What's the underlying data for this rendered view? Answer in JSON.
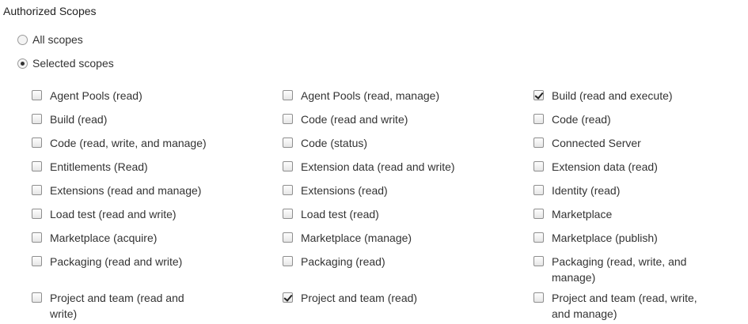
{
  "section": {
    "title": "Authorized Scopes"
  },
  "scope_mode": {
    "options": [
      {
        "label": "All scopes",
        "selected": false
      },
      {
        "label": "Selected scopes",
        "selected": true
      }
    ]
  },
  "scopes": [
    {
      "label": "Agent Pools (read)",
      "checked": false
    },
    {
      "label": "Agent Pools (read, manage)",
      "checked": false
    },
    {
      "label": "Build (read and execute)",
      "checked": true
    },
    {
      "label": "Build (read)",
      "checked": false
    },
    {
      "label": "Code (read and write)",
      "checked": false
    },
    {
      "label": "Code (read)",
      "checked": false
    },
    {
      "label": "Code (read, write, and manage)",
      "checked": false
    },
    {
      "label": "Code (status)",
      "checked": false
    },
    {
      "label": "Connected Server",
      "checked": false
    },
    {
      "label": "Entitlements (Read)",
      "checked": false
    },
    {
      "label": "Extension data (read and write)",
      "checked": false
    },
    {
      "label": "Extension data (read)",
      "checked": false
    },
    {
      "label": "Extensions (read and manage)",
      "checked": false
    },
    {
      "label": "Extensions (read)",
      "checked": false
    },
    {
      "label": "Identity (read)",
      "checked": false
    },
    {
      "label": "Load test (read and write)",
      "checked": false
    },
    {
      "label": "Load test (read)",
      "checked": false
    },
    {
      "label": "Marketplace",
      "checked": false
    },
    {
      "label": "Marketplace (acquire)",
      "checked": false
    },
    {
      "label": "Marketplace (manage)",
      "checked": false
    },
    {
      "label": "Marketplace (publish)",
      "checked": false
    },
    {
      "label": "Packaging (read and write)",
      "checked": false
    },
    {
      "label": "Packaging (read)",
      "checked": false
    },
    {
      "label": "Packaging (read, write, and manage)",
      "checked": false
    },
    {
      "label": "Project and team (read and write)",
      "checked": false
    },
    {
      "label": "Project and team (read)",
      "checked": true
    },
    {
      "label": "Project and team (read, write, and manage)",
      "checked": false
    }
  ]
}
